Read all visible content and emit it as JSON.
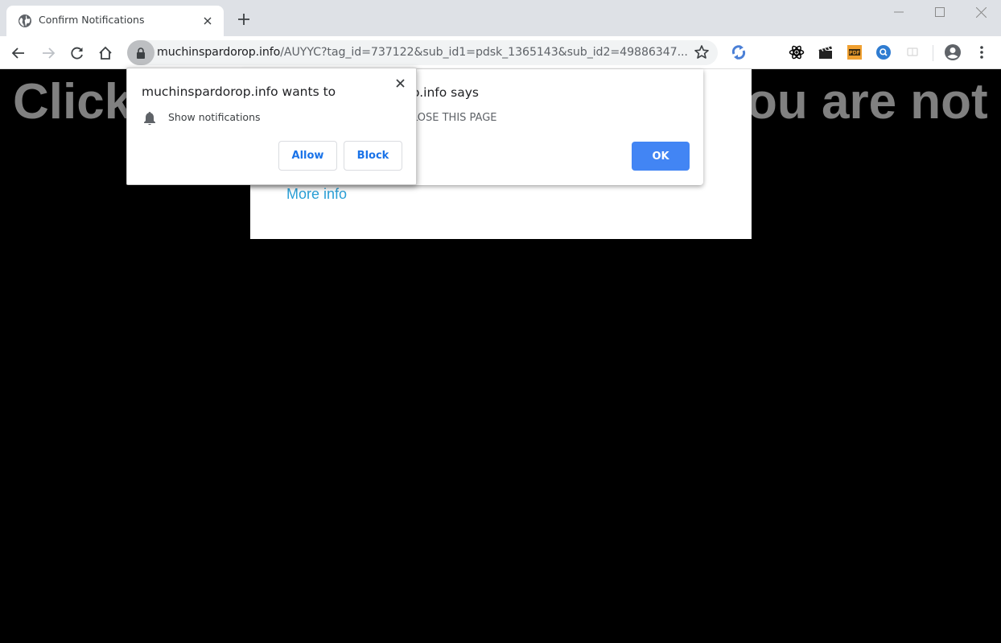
{
  "browser": {
    "tab": {
      "title": "Confirm Notifications",
      "favicon": "globe-icon",
      "close_label": "×"
    },
    "new_tab_label": "+",
    "window_controls": {
      "minimize": "minimize-icon",
      "maximize": "maximize-icon",
      "close": "close-icon"
    },
    "toolbar": {
      "back": "back-arrow-icon",
      "forward": "forward-arrow-icon",
      "reload": "reload-icon",
      "home": "home-icon"
    },
    "omnibox": {
      "security": "lock-icon",
      "host": "muchinspardorop.info",
      "path": "/AUYYC?tag_id=737122&sub_id1=pdsk_1365143&sub_id2=49886347..."
    },
    "extensions": [
      {
        "name": "sync-extension",
        "color": "#4a7fd6"
      },
      {
        "name": "atom-extension",
        "color": "#000000"
      },
      {
        "name": "clapperboard-extension",
        "color": "#222222"
      },
      {
        "name": "pdf-extension",
        "label": "PDF",
        "color": "#f0a030"
      },
      {
        "name": "search-extension",
        "color": "#2f7cd1"
      },
      {
        "name": "cast-extension",
        "color": "#d6d6d6"
      }
    ]
  },
  "page": {
    "headline_left": "Click",
    "headline_right": "ou are not",
    "more_info": "More info"
  },
  "alert": {
    "title": "muchinspardorop.info says",
    "title_visible": "o.info says",
    "message_visible": "LOSE THIS PAGE",
    "ok_label": "OK"
  },
  "permission_prompt": {
    "title": "muchinspardorop.info wants to",
    "permission": "Show notifications",
    "allow_label": "Allow",
    "block_label": "Block"
  },
  "colors": {
    "accent_blue": "#4285f4",
    "link_blue": "#2a9fd6",
    "button_text_blue": "#1a73e8",
    "headline_gray": "#808080"
  }
}
